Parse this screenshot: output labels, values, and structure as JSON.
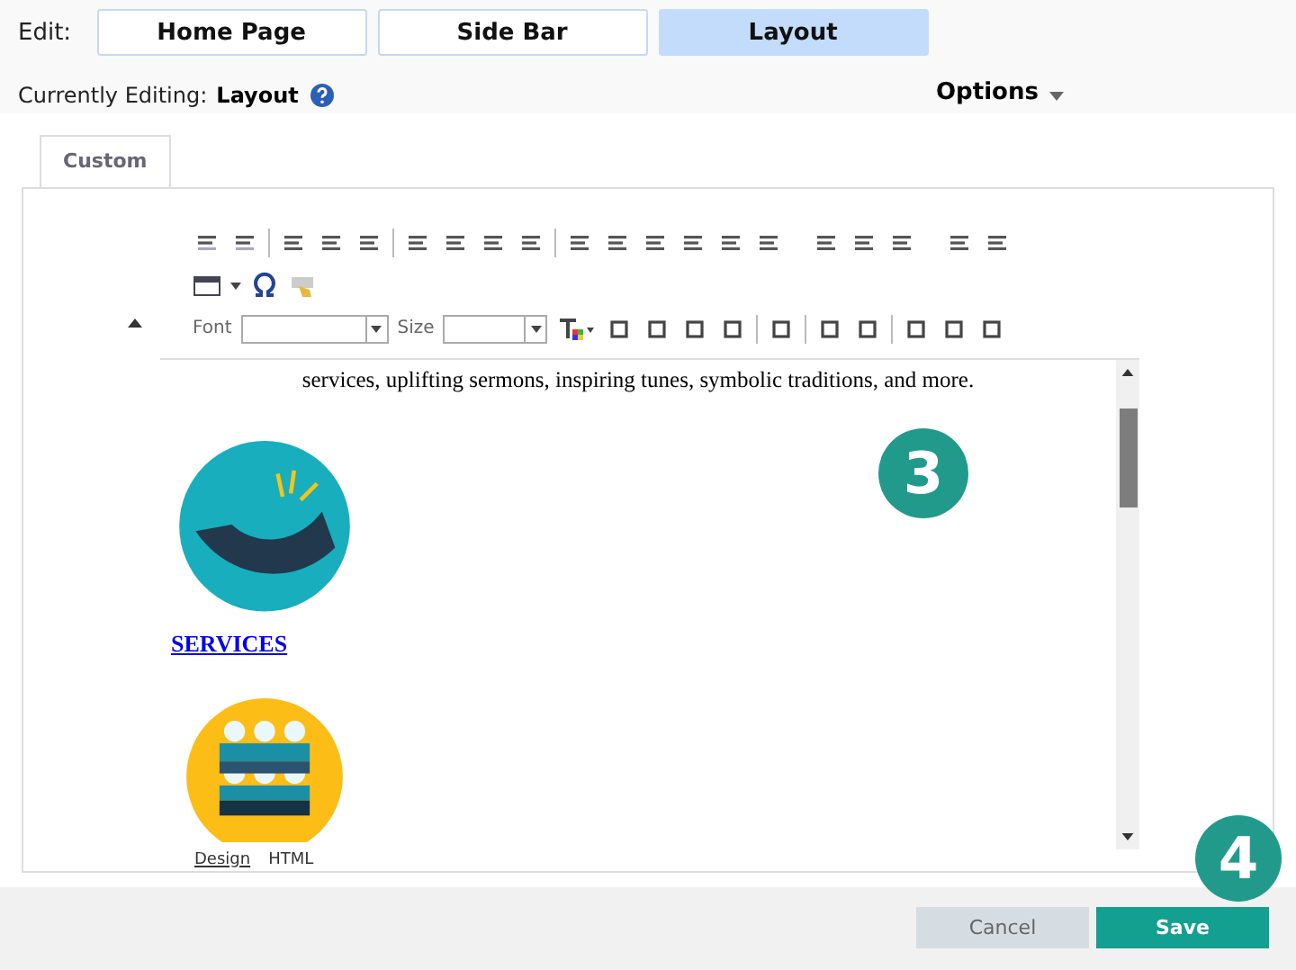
{
  "edit_bar": {
    "label": "Edit:",
    "tabs": [
      {
        "label": "Home Page",
        "selected": false
      },
      {
        "label": "Side Bar",
        "selected": false
      },
      {
        "label": "Layout",
        "selected": true
      }
    ]
  },
  "status": {
    "label": "Currently Editing:",
    "value": "Layout"
  },
  "options": {
    "label": "Options"
  },
  "panel_tabs": [
    {
      "label": "Custom",
      "selected": true
    }
  ],
  "toolbar": {
    "font_label": "Font",
    "size_label": "Size"
  },
  "content": {
    "paragraph": "services, uplifting sermons, inspiring tunes, symbolic traditions, and more.",
    "link": "SERVICES"
  },
  "mode_tabs": [
    {
      "label": "Design",
      "selected": true
    },
    {
      "label": "HTML",
      "selected": false
    }
  ],
  "callouts": [
    {
      "number": "3"
    },
    {
      "number": "4"
    }
  ],
  "footer": {
    "buttons": [
      {
        "label": "Cancel",
        "kind": "secondary"
      },
      {
        "label": "Save",
        "kind": "primary"
      }
    ]
  }
}
